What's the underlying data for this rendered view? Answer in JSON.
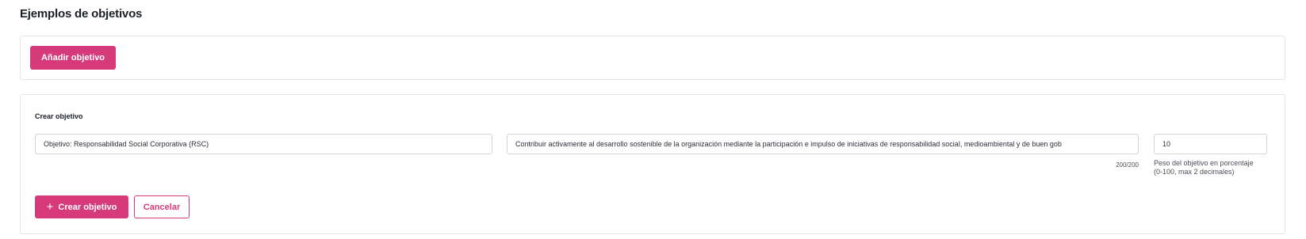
{
  "page": {
    "title": "Ejemplos de objetivos"
  },
  "toolbar": {
    "add_label": "Añadir objetivo"
  },
  "form": {
    "title": "Crear objetivo",
    "name_value": "Objetivo: Responsabilidad Social Corporativa (RSC)",
    "description_value": "Contribuir activamente al desarrollo sostenible de la organización mediante la participación e impulso de iniciativas de responsabilidad social, medioambiental y de buen gob",
    "description_counter": "200/200",
    "weight_value": "10",
    "weight_help": "Peso del objetivo en porcentaje (0-100, max 2 decimales)",
    "create_label": "Crear objetivo",
    "create_icon": "plus-icon",
    "cancel_label": "Cancelar"
  },
  "colors": {
    "accent": "#d63a7a",
    "border": "#e3e5ea",
    "input_border": "#cfd3da"
  }
}
